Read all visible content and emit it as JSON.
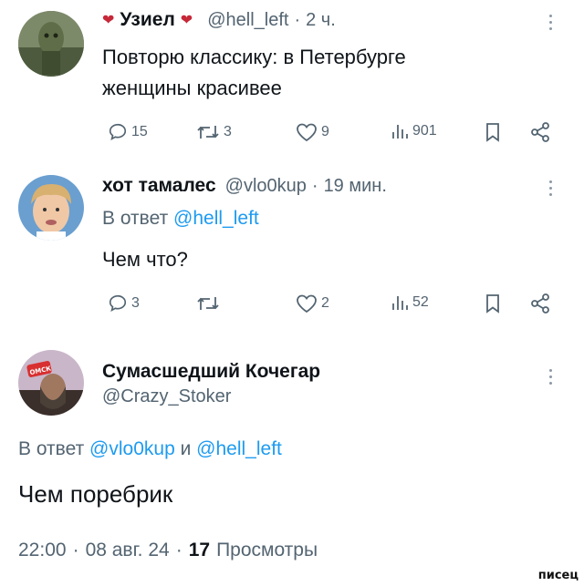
{
  "tweet1": {
    "display_name": "Узиел",
    "name_emoji": "❤",
    "handle": "@hell_left",
    "separator": "·",
    "time": "2 ч.",
    "text_line1": "Повторю классику: в Петербурге",
    "text_line2": "женщины красивее",
    "replies": "15",
    "retweets": "3",
    "likes": "9",
    "views": "901"
  },
  "tweet2": {
    "display_name": "хот тамалес",
    "handle": "@vlo0kup",
    "separator": "·",
    "time": "19 мин.",
    "reply_prefix": "В ответ",
    "reply_to": "@hell_left",
    "text": "Чем что?",
    "replies": "3",
    "likes": "2",
    "views": "52"
  },
  "tweet3": {
    "display_name": "Сумасшедший Кочегар",
    "handle": "@Crazy_Stoker",
    "avatar_badge": "ОМСК",
    "reply_prefix": "В ответ",
    "reply_to_1": "@vlo0kup",
    "reply_joiner": "и",
    "reply_to_2": "@hell_left",
    "text": "Чем поребрик",
    "time": "22:00",
    "separator": "·",
    "date": "08 авг. 24",
    "views_count": "17",
    "views_label": "Просмотры"
  },
  "watermark": "писец",
  "colors": {
    "link": "#1d9bf0",
    "secondary": "#536471",
    "primary": "#0f1419"
  }
}
